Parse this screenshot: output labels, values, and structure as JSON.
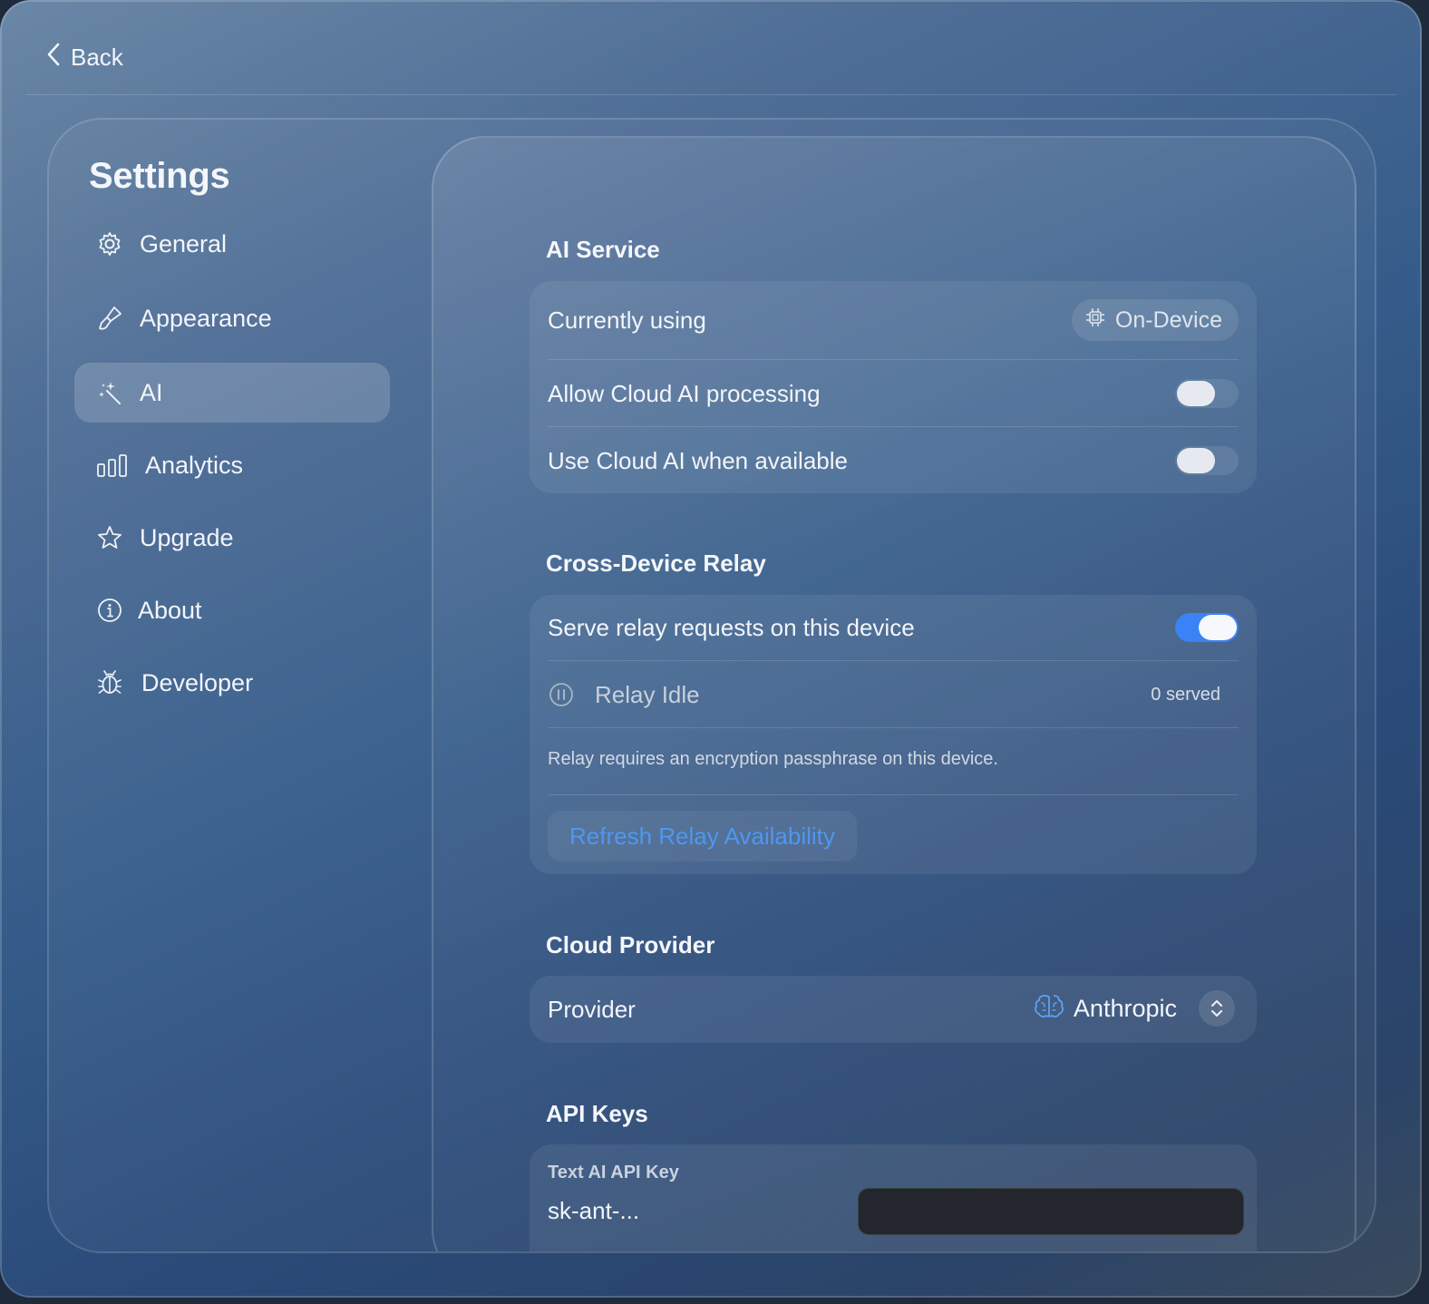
{
  "topbar": {
    "back_label": "Back"
  },
  "sidebar": {
    "title": "Settings",
    "items": [
      {
        "label": "General",
        "icon": "gear-icon"
      },
      {
        "label": "Appearance",
        "icon": "paintbrush-icon"
      },
      {
        "label": "AI",
        "icon": "magic-wand-icon",
        "active": true
      },
      {
        "label": "Analytics",
        "icon": "bar-chart-icon"
      },
      {
        "label": "Upgrade",
        "icon": "star-icon"
      },
      {
        "label": "About",
        "icon": "info-icon"
      },
      {
        "label": "Developer",
        "icon": "bug-icon"
      }
    ]
  },
  "ai_service": {
    "title": "AI Service",
    "currently_using_label": "Currently using",
    "currently_using_value": "On-Device",
    "allow_cloud_label": "Allow Cloud AI processing",
    "allow_cloud_on": false,
    "use_cloud_label": "Use Cloud AI when available",
    "use_cloud_on": false
  },
  "relay": {
    "title": "Cross-Device Relay",
    "serve_label": "Serve relay requests on this device",
    "serve_on": true,
    "status": "Relay Idle",
    "served": "0 served",
    "note": "Relay requires an encryption passphrase on this device.",
    "refresh_label": "Refresh Relay Availability"
  },
  "cloud_provider": {
    "title": "Cloud Provider",
    "provider_label": "Provider",
    "provider_value": "Anthropic"
  },
  "api_keys": {
    "title": "API Keys",
    "text_key_label": "Text AI API Key",
    "text_key_value": "sk-ant-...",
    "text_key_input": ""
  },
  "colors": {
    "accent": "#3b82f6",
    "link": "#4f97f0"
  }
}
